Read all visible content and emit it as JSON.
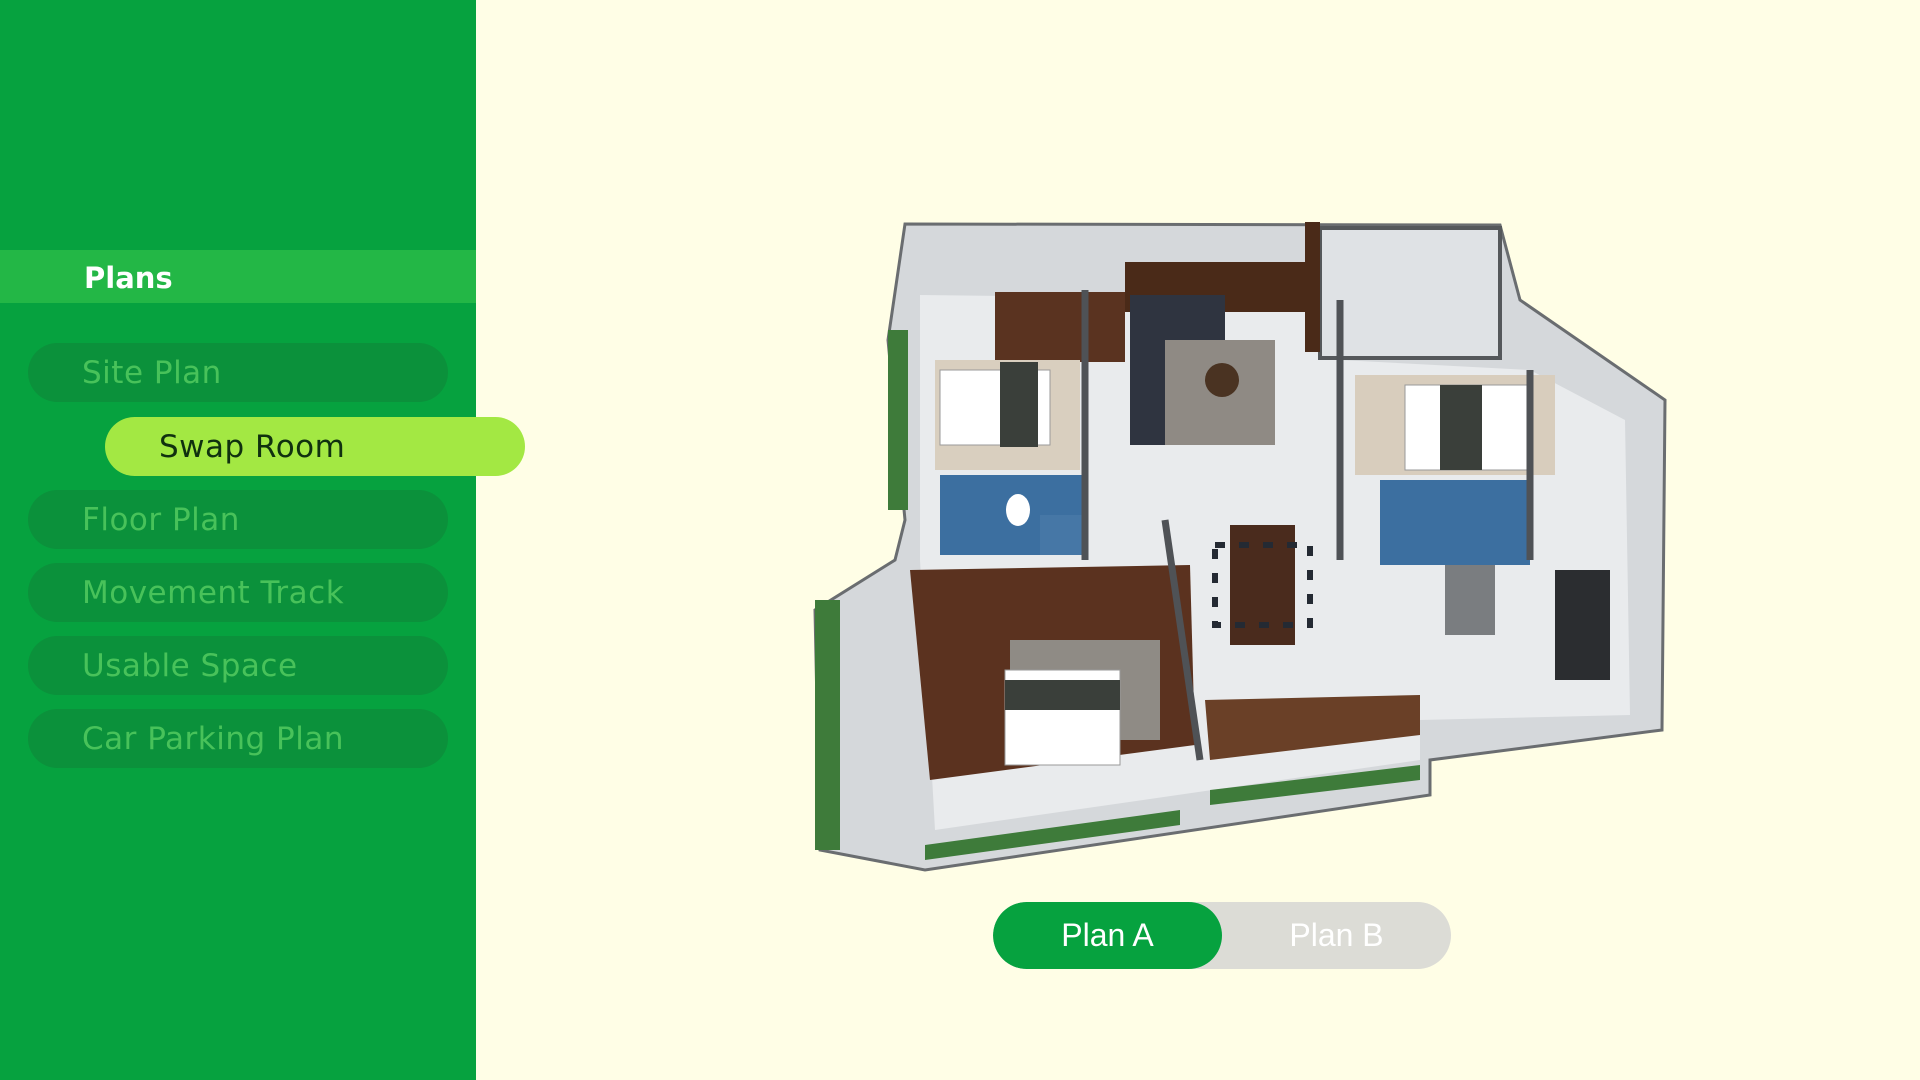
{
  "sidebar": {
    "header": "Plans",
    "items": [
      {
        "label": "Site Plan"
      },
      {
        "label": "Swap Room",
        "active": true
      },
      {
        "label": "Floor Plan"
      },
      {
        "label": "Movement Track"
      },
      {
        "label": "Usable Space"
      },
      {
        "label": "Car Parking Plan"
      }
    ]
  },
  "plan_toggle": {
    "options": [
      "Plan A",
      "Plan B"
    ],
    "selected": "Plan A"
  },
  "colors": {
    "sidebar_bg": "#06a23f",
    "header_bg": "#23b746",
    "active_pill": "#a3e843",
    "inactive_pill": "#0b913b",
    "page_bg": "#fffee6",
    "toggle_off": "#dcdcd6"
  }
}
